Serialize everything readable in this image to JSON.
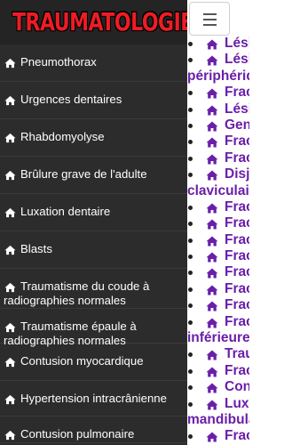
{
  "app": {
    "logo_text": "TRAUMATOLOGIE"
  },
  "drawer": {
    "items": [
      {
        "label": "Pneumothorax"
      },
      {
        "label": "Urgences dentaires"
      },
      {
        "label": "Rhabdomyolyse"
      },
      {
        "label": "Brûlure grave de l'adulte"
      },
      {
        "label": "Luxation dentaire"
      },
      {
        "label": "Blasts"
      },
      {
        "label": "Traumatisme du coude à radiographies normales"
      },
      {
        "label": "Traumatisme épaule à radiographies normales"
      },
      {
        "label": "Contusion myocardique"
      },
      {
        "label": "Hypertension intracrânienne"
      },
      {
        "label": "Contusion pulmonaire"
      }
    ]
  },
  "main": {
    "menu_button_icon": "hamburger-icon",
    "links": [
      {
        "text": "Lési",
        "cont": false
      },
      {
        "text": "Lési",
        "cont": false
      },
      {
        "text": "périphériqu",
        "cont": true
      },
      {
        "text": "Frac",
        "cont": false
      },
      {
        "text": "Lési",
        "cont": false
      },
      {
        "text": "Gen",
        "cont": false
      },
      {
        "text": "Frac",
        "cont": false
      },
      {
        "text": "Frac",
        "cont": false
      },
      {
        "text": "Disj",
        "cont": false
      },
      {
        "text": "claviculair",
        "cont": true
      },
      {
        "text": "Frac",
        "cont": false
      },
      {
        "text": "Frac",
        "cont": false
      },
      {
        "text": "Frac",
        "cont": false
      },
      {
        "text": "Frac",
        "cont": false
      },
      {
        "text": "Frac",
        "cont": false
      },
      {
        "text": "Frac",
        "cont": false
      },
      {
        "text": "Frac",
        "cont": false
      },
      {
        "text": "Frac",
        "cont": false
      },
      {
        "text": "inférieure",
        "cont": true
      },
      {
        "text": "Trau",
        "cont": false
      },
      {
        "text": "Frac",
        "cont": false
      },
      {
        "text": "Con",
        "cont": false
      },
      {
        "text": "Luxa",
        "cont": false
      },
      {
        "text": "mandibula",
        "cont": true
      },
      {
        "text": "Frac",
        "cont": false
      }
    ]
  },
  "colors": {
    "drawer_bg": "#2c2c2c",
    "logo_red": "#ee1c24",
    "link_purple": "#6a1fa8"
  }
}
